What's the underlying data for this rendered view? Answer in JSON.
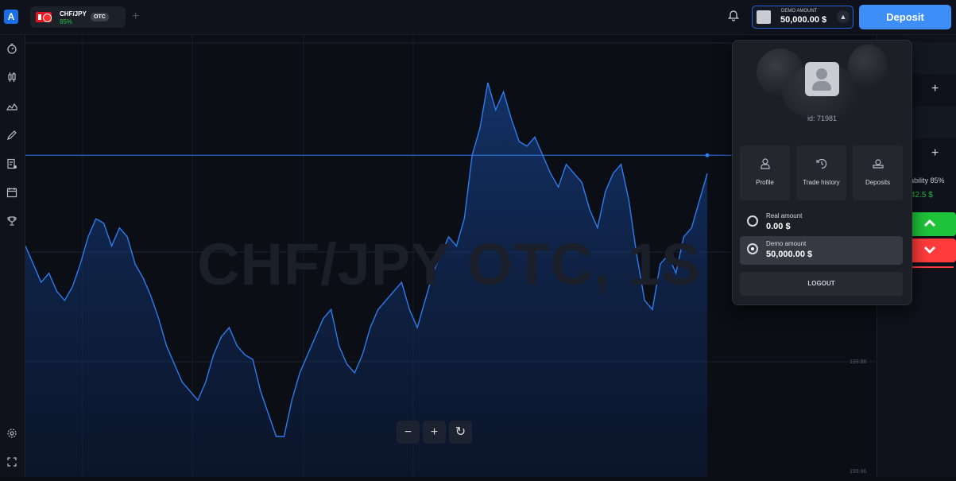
{
  "header": {
    "logo_letter": "A",
    "asset": {
      "name": "CHF/JPY",
      "payout": "85%",
      "badge": "OTC"
    },
    "add_tab_label": "+",
    "account": {
      "label": "DEMO AMOUNT",
      "value": "50,000.00 $"
    },
    "deposit_label": "Deposit"
  },
  "sidebar": {
    "icons": [
      "timer-icon",
      "candles-icon",
      "chart-area-icon",
      "drawing-pen-icon",
      "trades-list-icon",
      "calendar-icon",
      "trophy-icon",
      "settings-icon",
      "fullscreen-icon"
    ]
  },
  "chart": {
    "watermark": "CHF/JPY OTC, 1S",
    "price_ticks": [
      "199.88",
      "199.86"
    ],
    "zoom": {
      "minus": "−",
      "plus": "+",
      "reset": "↻"
    }
  },
  "chart_data": {
    "type": "area",
    "title": "",
    "series": [
      {
        "values": [
          42,
          38,
          34,
          36,
          32,
          30,
          33,
          38,
          44,
          48,
          47,
          42,
          46,
          44,
          38,
          35,
          31,
          26,
          20,
          16,
          12,
          10,
          8,
          12,
          18,
          22,
          24,
          20,
          18,
          17,
          10,
          5,
          0,
          0,
          8,
          14,
          18,
          22,
          26,
          28,
          20,
          16,
          14,
          18,
          24,
          28,
          30,
          32,
          34,
          28,
          24,
          30,
          36,
          40,
          44,
          42,
          48,
          62,
          68,
          78,
          72,
          76,
          70,
          65,
          64,
          66,
          62,
          58,
          55,
          60,
          58,
          56,
          50,
          46,
          54,
          58,
          60,
          52,
          40,
          30,
          28,
          38,
          40,
          36,
          44,
          46,
          52,
          58
        ]
      }
    ],
    "current_price_level": 62
  },
  "popup": {
    "user_id": "id: 71981",
    "tiles": [
      {
        "icon": "profile-icon",
        "label": "Profile"
      },
      {
        "icon": "history-icon",
        "label": "Trade history"
      },
      {
        "icon": "deposits-icon",
        "label": "Deposits"
      }
    ],
    "accounts": [
      {
        "label": "Real amount",
        "value": "0.00 $",
        "selected": false
      },
      {
        "label": "Demo amount",
        "value": "50,000.00 $",
        "selected": true
      }
    ],
    "logout_label": "LOGOUT"
  },
  "right_panel": {
    "plus": "+",
    "profitability": "ability 85%",
    "profit_value": "42.5 $",
    "up_icon": "chevron-up-icon",
    "down_icon": "chevron-down-icon"
  }
}
